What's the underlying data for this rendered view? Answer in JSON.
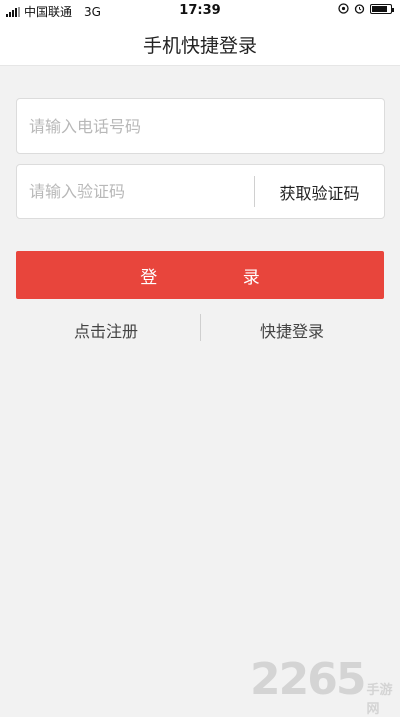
{
  "status_bar": {
    "carrier": "中国联通",
    "network": "3G",
    "time": "17:39",
    "battery_level": 0.85
  },
  "header": {
    "title": "手机快捷登录"
  },
  "form": {
    "phone_placeholder": "请输入电话号码",
    "code_placeholder": "请输入验证码",
    "get_code_label": "获取验证码",
    "login_label": "登 录"
  },
  "links": {
    "register": "点击注册",
    "quick_login": "快捷登录"
  },
  "watermark": {
    "number": "2265",
    "text": "手游网"
  },
  "colors": {
    "accent": "#e8453c",
    "background": "#f2f2f2"
  },
  "icons": [
    "signal-icon",
    "location-icon",
    "alarm-icon",
    "battery-icon"
  ]
}
